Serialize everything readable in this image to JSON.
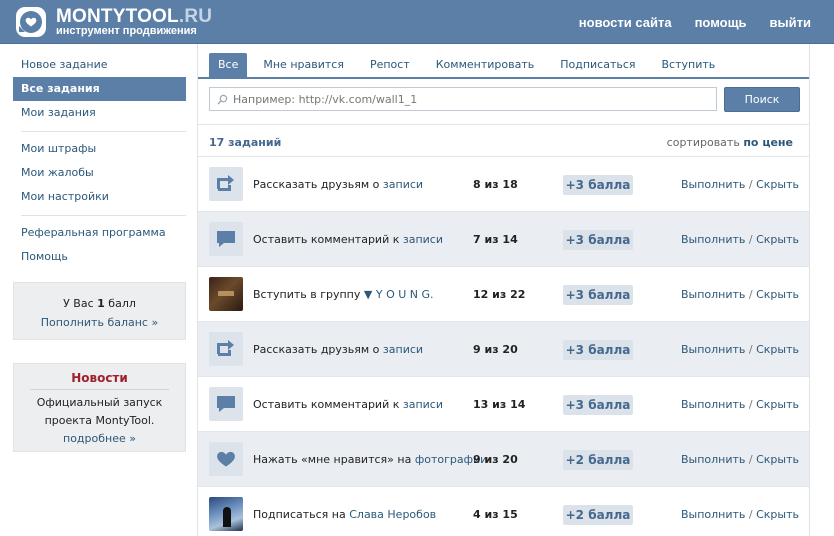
{
  "header": {
    "logo_main": "MONTYTOOL",
    "logo_tld": ".RU",
    "logo_sub": "инструмент продвижения",
    "nav": [
      "новости сайта",
      "помощь",
      "выйти"
    ]
  },
  "sidebar": {
    "items": [
      "Новое задание",
      "Все задания",
      "Мои задания"
    ],
    "items2": [
      "Мои штрафы",
      "Мои жалобы",
      "Мои настройки"
    ],
    "items3": [
      "Реферальная программа",
      "Помощь"
    ]
  },
  "balance": {
    "prefix": "У Вас",
    "amount": "1",
    "suffix": "балл",
    "link": "Пополнить баланс »"
  },
  "news": {
    "title": "Новости",
    "text": "Официальный запуск проекта MontyTool.",
    "link": "подробнее »"
  },
  "main": {
    "tabs": [
      "Все",
      "Мне нравится",
      "Репост",
      "Комментировать",
      "Подписаться",
      "Вступить"
    ],
    "search_placeholder": "Например: http://vk.com/wall1_1",
    "search_button": "Поиск",
    "count": "17 заданий",
    "sort_label": "сортировать",
    "sort_value": "по цене",
    "action_do": "Выполнить",
    "action_sep": "/",
    "action_hide": "Скрыть"
  },
  "tasks": [
    {
      "icon": "repost-icon",
      "text": "Рассказать друзьям о",
      "link": "записи",
      "count": "8 из 18",
      "points": "+3 балла"
    },
    {
      "icon": "comment-icon",
      "text": "Оставить комментарий к",
      "link": "записи",
      "count": "7 из 14",
      "points": "+3 балла"
    },
    {
      "icon": "group-avatar",
      "text": "Вступить в группу",
      "link": "▼ Y O U N G.",
      "count": "12 из 22",
      "points": "+3 балла"
    },
    {
      "icon": "repost-icon",
      "text": "Рассказать друзьям о",
      "link": "записи",
      "count": "9 из 20",
      "points": "+3 балла"
    },
    {
      "icon": "comment-icon",
      "text": "Оставить комментарий к",
      "link": "записи",
      "count": "13 из 14",
      "points": "+3 балла"
    },
    {
      "icon": "heart-icon",
      "text": "Нажать «мне нравится» на",
      "link": "фотографии",
      "count": "9 из 20",
      "points": "+2 балла"
    },
    {
      "icon": "user-avatar",
      "text": "Подписаться на",
      "link": "Слава Неробов",
      "count": "4 из 15",
      "points": "+2 балла"
    }
  ],
  "colors": {
    "accent": "#5b7fa6",
    "link": "#2b587a",
    "news_title": "#a0202d"
  }
}
